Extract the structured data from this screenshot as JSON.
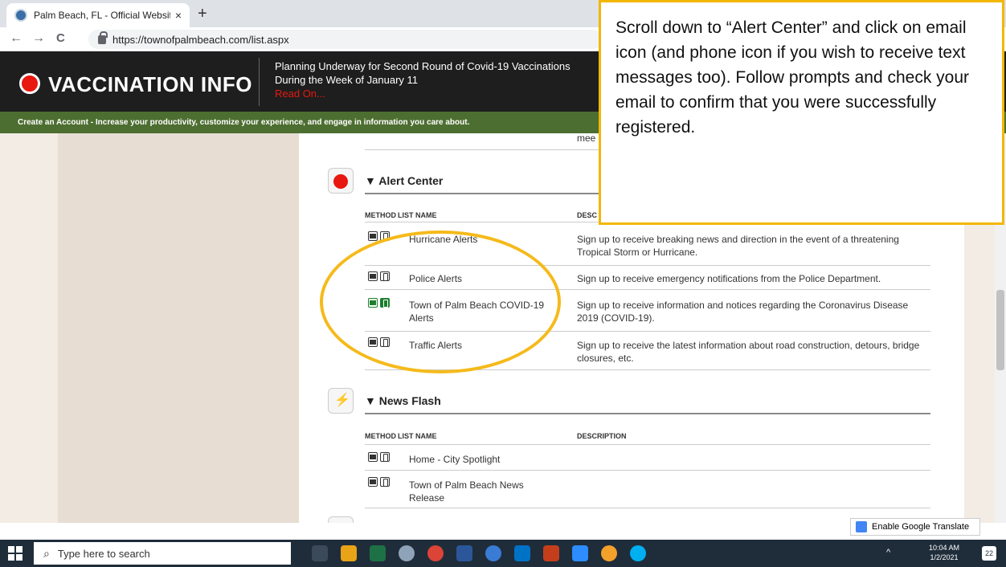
{
  "browser": {
    "tab_title": "Palm Beach, FL - Official Website",
    "tab_close": "×",
    "new_tab": "+",
    "url": "https://townofpalmbeach.com/list.aspx",
    "back": "←",
    "forward": "→",
    "reload": "C"
  },
  "banner": {
    "title": "VACCINATION INFO",
    "headline": "Planning Underway for Second Round of Covid-19 Vaccinations During the Week of January 11",
    "read_on": "Read On..."
  },
  "greenbar": {
    "text": "Create an Account - Increase your productivity, customize your experience, and engage in information you care about."
  },
  "partial_text": "mee",
  "alert_center": {
    "heading": "▼ Alert Center",
    "col_method": "METHOD",
    "col_list": "LIST NAME",
    "col_desc": "DESC",
    "rows": [
      {
        "name": "Hurricane Alerts",
        "desc": "Sign up to receive breaking news and direction in the event of a threatening Tropical Storm or Hurricane."
      },
      {
        "name": "Police Alerts",
        "desc": "Sign up to receive emergency notifications from the Police Department."
      },
      {
        "name": "Town of Palm Beach COVID-19 Alerts",
        "desc": "Sign up to receive information and notices regarding the Coronavirus Disease 2019 (COVID-19)."
      },
      {
        "name": "Traffic Alerts",
        "desc": "Sign up to receive the latest information about road construction, detours, bridge closures, etc."
      }
    ]
  },
  "news_flash": {
    "heading": "▼ News Flash",
    "col_method": "METHOD",
    "col_list": "LIST NAME",
    "col_desc": "DESCRIPTION",
    "rows": [
      {
        "name": "Home - City Spotlight"
      },
      {
        "name": "Town of Palm Beach News Release"
      }
    ]
  },
  "note": {
    "text": "Scroll down to “Alert Center” and click on email icon (and phone icon if you wish to receive text messages too). Follow prompts and check your email to confirm that you were successfully registered."
  },
  "translate": {
    "label": "Enable Google Translate"
  },
  "taskbar": {
    "search_placeholder": "Type here to search",
    "time": "10:04 AM",
    "date": "1/2/2021",
    "notifications": "22",
    "tray": "^"
  },
  "colors": {
    "banner_bg": "#1e1e1e",
    "greenbar_bg": "#4d6e31",
    "alert_red": "#e8170f",
    "highlight": "#f5ba1b"
  }
}
